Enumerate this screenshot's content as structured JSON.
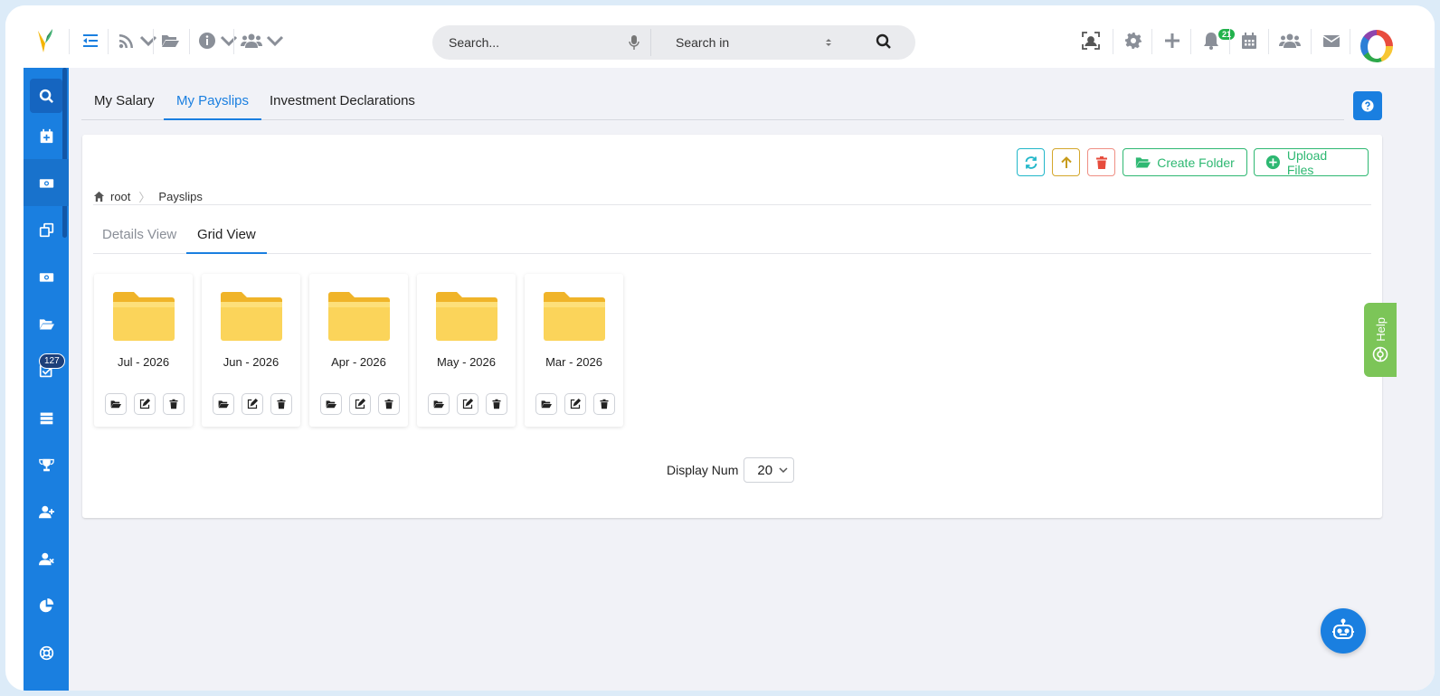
{
  "topbar": {
    "search_placeholder": "Search...",
    "search_in_label": "Search in",
    "notification_count": "21"
  },
  "sidebar": {
    "badge_count": "127",
    "items": [
      "search",
      "calendar-add",
      "money",
      "copy",
      "money-alt",
      "folder",
      "task",
      "list",
      "trophy",
      "user-add",
      "user-remove",
      "pie-chart",
      "support"
    ]
  },
  "tabs": [
    "My Salary",
    "My Payslips",
    "Investment Declarations"
  ],
  "active_tab": "My Payslips",
  "toolbar": {
    "create_folder": "Create Folder",
    "upload_files": "Upload Files"
  },
  "breadcrumb": [
    "root",
    "Payslips"
  ],
  "view_tabs": [
    "Details View",
    "Grid View"
  ],
  "active_view": "Grid View",
  "folders": [
    {
      "name": "Jul - 2026"
    },
    {
      "name": "Jun - 2026"
    },
    {
      "name": "Apr - 2026"
    },
    {
      "name": "May - 2026"
    },
    {
      "name": "Mar - 2026"
    }
  ],
  "display_num": {
    "label": "Display Num",
    "value": "20"
  },
  "help_label": "Help",
  "colors": {
    "primary": "#1a7fe0",
    "success": "#2eb872",
    "folder": "#f7c633"
  }
}
